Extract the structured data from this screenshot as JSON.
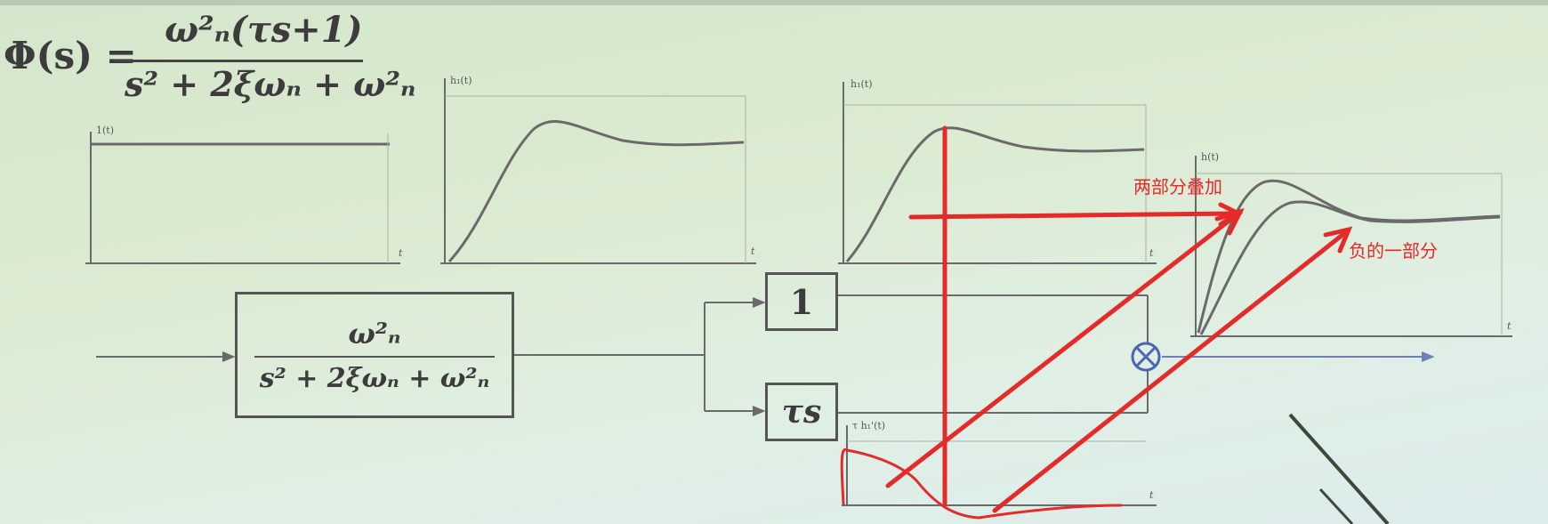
{
  "formula": {
    "lhs": "Φ(s) =",
    "numerator": "ω²ₙ(τs+1)",
    "denominator": "s² + 2ξωₙ + ω²ₙ"
  },
  "block_main": {
    "numerator": "ω²ₙ",
    "denominator": "s² + 2ξωₙ + ω²ₙ"
  },
  "block_one": "1",
  "block_tau": "τs",
  "plots": {
    "step_input_label": "1(t)",
    "response_label": "h₁(t)",
    "response2_label": "h₁(t)",
    "combined_label": "h(t)",
    "derivative_label": "τ h₁'(t)",
    "t_label": "t"
  },
  "annotations": {
    "superposition": "两部分叠加",
    "negative_part": "负的一部分"
  },
  "colors": {
    "background": "#dcebd2",
    "ink": "#555555",
    "annotation": "#e52a2a",
    "summing_junction": "#4a64b8"
  }
}
